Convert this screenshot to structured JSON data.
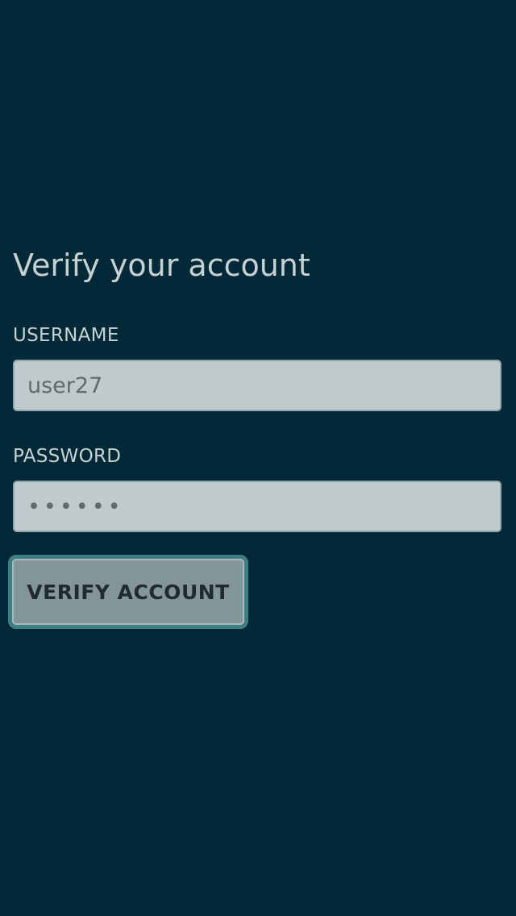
{
  "page": {
    "title": "Verify your account"
  },
  "form": {
    "username": {
      "label": "USERNAME",
      "value": "user27"
    },
    "password": {
      "label": "PASSWORD",
      "masked_value": "••••••"
    },
    "submit_label": "VERIFY ACCOUNT"
  },
  "colors": {
    "background": "#012937",
    "text": "#c7d1d3",
    "field_background": "#c0cacc",
    "button_background": "#849598",
    "button_border": "#3f7f84"
  }
}
